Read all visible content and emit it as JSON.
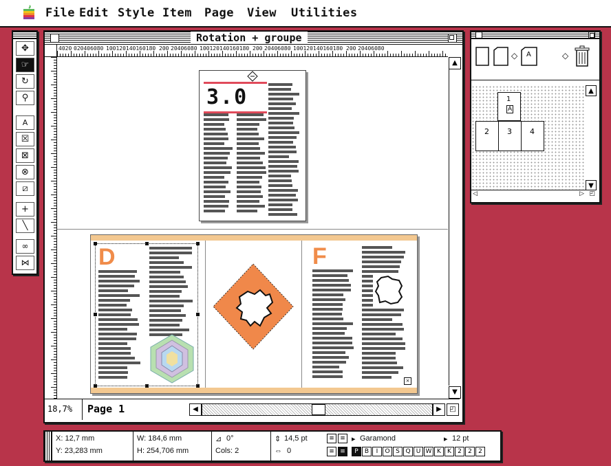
{
  "menubar": {
    "items": [
      "File",
      "Edit",
      "Style",
      "Item",
      "Page",
      "View",
      "Utilities"
    ]
  },
  "document_window": {
    "title": "Rotation + groupe",
    "ruler_h_labels": [
      "4020",
      "020406080",
      "100120140160180",
      "200",
      "20406080",
      "100120140160180",
      "200",
      "20406080",
      "100120140160180",
      "200",
      "20406080"
    ],
    "zoom": "18,7%",
    "page_label": "Page 1",
    "spread_left_letter": "D",
    "spread_right_letter": "F",
    "title_page_heading": "3.0"
  },
  "pages_palette": {
    "pages": [
      "1",
      "2",
      "3",
      "4"
    ],
    "master_label": "A"
  },
  "measurements": {
    "x": "X: 12,7 mm",
    "y": "Y: 23,283 mm",
    "w": "W: 184,6 mm",
    "h": "H: 254,706 mm",
    "angle": "0°",
    "cols": "Cols: 2",
    "leading": "14,5 pt",
    "tracking": "0",
    "font": "Garamond",
    "size": "12 pt",
    "style_buttons": [
      "P",
      "B",
      "I",
      "O",
      "S",
      "Q",
      "U",
      "W",
      "K",
      "K",
      "2",
      "2",
      "2"
    ]
  },
  "tools": [
    {
      "name": "item-tool",
      "glyph": "✥"
    },
    {
      "name": "content-tool",
      "glyph": "☞"
    },
    {
      "name": "rotation-tool",
      "glyph": "↻"
    },
    {
      "name": "zoom-tool",
      "glyph": "🔍"
    },
    {
      "name": "text-box-tool",
      "glyph": "A"
    },
    {
      "name": "rect-picture-tool",
      "glyph": "☒"
    },
    {
      "name": "rounded-picture-tool",
      "glyph": "⊠"
    },
    {
      "name": "oval-picture-tool",
      "glyph": "⊗"
    },
    {
      "name": "polygon-picture-tool",
      "glyph": "⧄"
    },
    {
      "name": "orthogonal-line-tool",
      "glyph": "+"
    },
    {
      "name": "line-tool",
      "glyph": "╲"
    },
    {
      "name": "linking-tool",
      "glyph": "∞"
    },
    {
      "name": "unlinking-tool",
      "glyph": "⋈"
    }
  ],
  "colors": {
    "desktop": "#b8344a",
    "accent_orange": "#f08c4a",
    "map_orange": "#f0884a",
    "title_red": "#e04a5a"
  }
}
